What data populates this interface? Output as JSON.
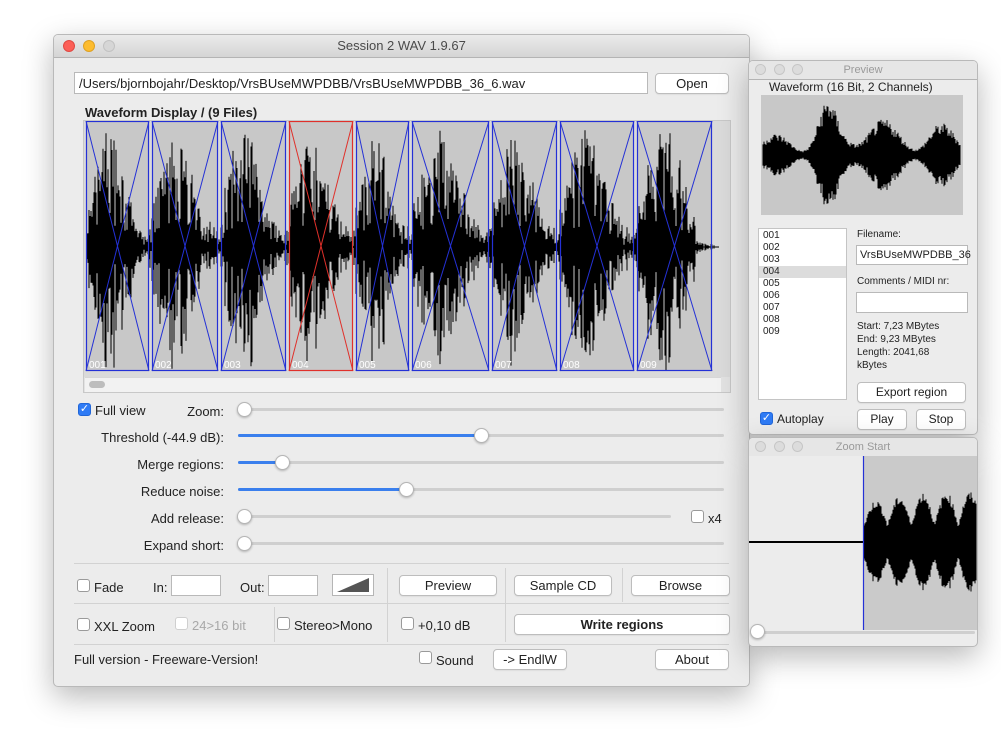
{
  "main_window": {
    "title": "Session 2 WAV 1.9.67",
    "file_path": "/Users/bjornbojahr/Desktop/VrsBUseMWPDBB/VrsBUseMWPDBB_36_6.wav",
    "open_label": "Open",
    "waveform_heading": "Waveform Display / (9 Files)",
    "regions": [
      "001",
      "002",
      "003",
      "004",
      "005",
      "006",
      "007",
      "008",
      "009"
    ],
    "selected_region": "004",
    "full_view_label": "Full view",
    "full_view_checked": true,
    "zoom_label": "Zoom:",
    "zoom_level": 0,
    "sliders": [
      {
        "label": "Threshold (-44.9 dB):",
        "level": 0.5
      },
      {
        "label": "Merge regions:",
        "level": 0.09
      },
      {
        "label": "Reduce noise:",
        "level": 0.35
      },
      {
        "label": "Add release:",
        "level": 0.0
      },
      {
        "label": "Expand short:",
        "level": 0.0
      }
    ],
    "x4_label": "x4",
    "fade_label": "Fade",
    "in_label": "In:",
    "out_label": "Out:",
    "preview_label": "Preview",
    "sample_cd_label": "Sample CD",
    "browse_label": "Browse",
    "xxl_zoom_label": "XXL Zoom",
    "bit_label": "24>16 bit",
    "stereo_mono_label": "Stereo>Mono",
    "db_label": "+0,10 dB",
    "write_regions_label": "Write regions",
    "version_text": "Full version -  Freeware-Version!",
    "sound_label": "Sound",
    "endlw_label": "-> EndlW",
    "about_label": "About"
  },
  "preview_window": {
    "title": "Preview",
    "waveform_label": "Waveform (16 Bit, 2 Channels)",
    "files": [
      "001",
      "002",
      "003",
      "004",
      "005",
      "006",
      "007",
      "008",
      "009"
    ],
    "selected_file": "004",
    "filename_label": "Filename:",
    "filename_value": "VrsBUseMWPDBB_36",
    "comments_label": "Comments / MIDI nr:",
    "comments_value": "",
    "start_text": "Start: 7,23 MBytes",
    "end_text": "End: 9,23 MBytes",
    "length_text": "Length: 2041,68",
    "length_unit": "kBytes",
    "export_label": "Export region",
    "autoplay_label": "Autoplay",
    "autoplay_checked": true,
    "play_label": "Play",
    "stop_label": "Stop"
  },
  "zoom_window": {
    "title": "Zoom Start",
    "slider_level": 0
  },
  "colors": {
    "region_border": "#2431d6",
    "selected_region_border": "#e0302a",
    "accent": "#3a7fed",
    "wave_bg": "#c8c8c8"
  }
}
